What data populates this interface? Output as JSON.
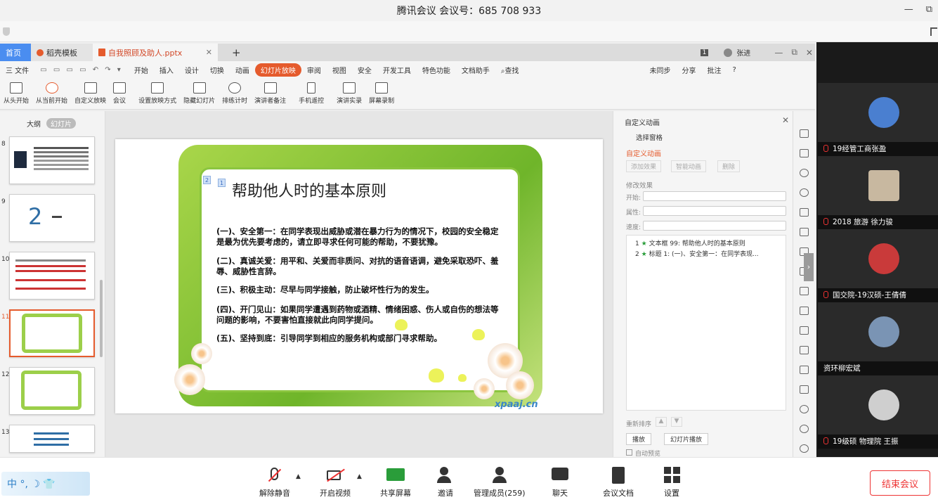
{
  "window": {
    "title": "腾讯会议 会议号：685 708 933",
    "minimize": "—",
    "restore": "⧉"
  },
  "wps": {
    "tabs": [
      "首页",
      "稻壳模板",
      "自我照顾及助人.pptx"
    ],
    "tab_plus": "+",
    "page_indicator": "1",
    "user": "张进",
    "menus": [
      "三 文件",
      "开始",
      "插入",
      "设计",
      "切换",
      "动画",
      "幻灯片放映",
      "审阅",
      "视图",
      "安全",
      "开发工具",
      "特色功能",
      "文档助手",
      "查找"
    ],
    "menu_active": "幻灯片放映",
    "menu_right": [
      "未同步",
      "分享",
      "批注"
    ],
    "toolbar": [
      "从头开始",
      "从当前开始",
      "自定义放映",
      "会议",
      "设置放映方式",
      "隐藏幻灯片",
      "排练计时",
      "演讲者备注",
      "手机遥控",
      "演讲实录",
      "屏幕录制"
    ],
    "thumb_tabs": [
      "大纲",
      "幻灯片"
    ],
    "thumb_numbers": [
      "8",
      "9",
      "10",
      "11",
      "12",
      "13"
    ],
    "thumb_active": "11",
    "thumb9_big": "2",
    "slide": {
      "title": "帮助他人时的基本原则",
      "badges": [
        "2",
        "1"
      ],
      "paragraphs": [
        "(一)、安全第一：在同学表现出威胁或潜在暴力行为的情况下，校园的安全稳定是最为优先要考虑的，请立即寻求任何可能的帮助，不要犹豫。",
        "(二)、真诚关爱：用平和、关爱而非质问、对抗的语音语调，避免采取恐吓、羞辱、威胁性言辞。",
        "(三)、积极主动：尽早与同学接触，防止破坏性行为的发生。",
        "(四)、开门见山：如果同学遭遇到药物或酒精、情绪困惑、伤人或自伤的想法等问题的影响，不要害怕直接就此向同学提问。",
        "(五)、坚持到底：引导同学到相应的服务机构或部门寻求帮助。"
      ],
      "watermark": "xpaaj.cn"
    },
    "anim_panel": {
      "title": "自定义动画",
      "select_pane": "选择窗格",
      "section": "自定义动画",
      "add_effect": "添加效果",
      "smart_anim": "智能动画",
      "delete": "删除",
      "modify": "修改效果",
      "start_label": "开始:",
      "property_label": "属性:",
      "speed_label": "速度:",
      "items": [
        {
          "num": "1",
          "text": "文本框 99: 帮助他人时的基本原则"
        },
        {
          "num": "2",
          "text": "标题 1:    (一)、安全第一：在同学表现..."
        }
      ],
      "reorder": "重新排序",
      "play": "播放",
      "slideshow": "幻灯片播放",
      "autopreview": "自动预览"
    }
  },
  "participants": [
    {
      "name": "19经管工商张盈",
      "avatar_color": "#4a7fd0"
    },
    {
      "name": "2018 旅游 徐力骏",
      "avatar_color": "#c8b8a0"
    },
    {
      "name": "国交院-19汉硕-王倩倩",
      "avatar_color": "#c93a3a"
    },
    {
      "name": "资环柳宏斌",
      "avatar_color": "#7a94b4"
    },
    {
      "name": "19级硕 物理院 王振",
      "avatar_color": "#cfcfcf"
    }
  ],
  "bottom": {
    "ime": "中 °, ☽ 👕",
    "buttons": [
      "解除静音",
      "开启视频",
      "共享屏幕",
      "邀请",
      "管理成员(259)",
      "聊天",
      "会议文档",
      "设置"
    ],
    "end": "结束会议"
  },
  "colors": {
    "accent": "#e55b2d",
    "tencent_blue": "#2c7fc7",
    "end_red": "#e33333",
    "slide_green": "#8bc53f"
  }
}
